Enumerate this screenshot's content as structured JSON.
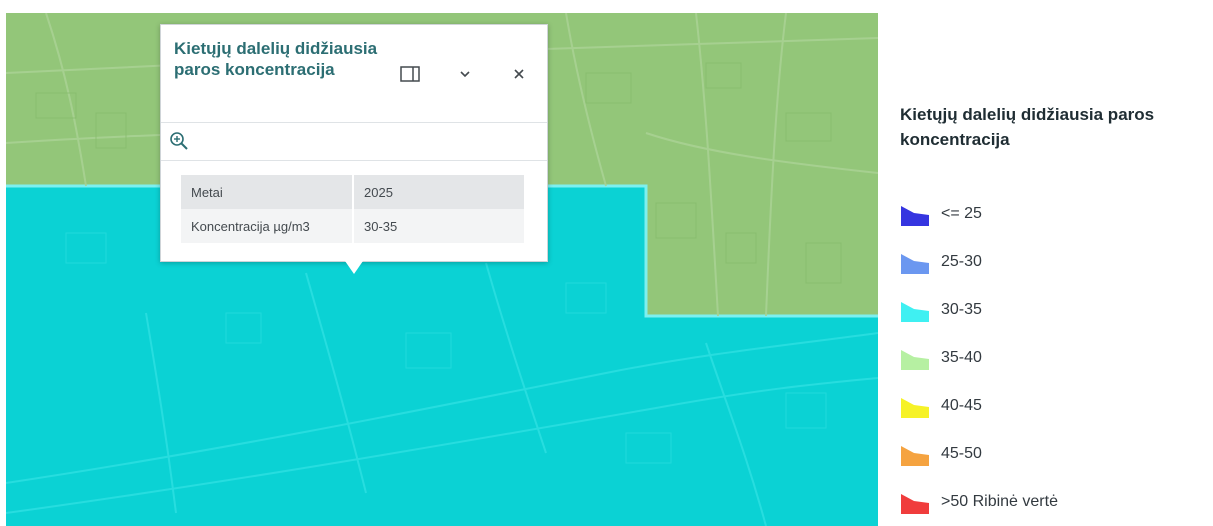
{
  "popup": {
    "title": "Kietųjų dalelių didžiausia paros koncentracija",
    "buttons": {
      "dock_icon": "dock-panel-icon",
      "collapse_icon": "chevron-down-icon",
      "close_icon": "close-icon",
      "zoom_icon": "zoom-to-icon"
    },
    "attributes": [
      {
        "key": "Metai",
        "value": "2025"
      },
      {
        "key": "Koncentracija µg/m3",
        "value": "30-35"
      }
    ]
  },
  "legend": {
    "title": "Kietųjų dalelių didžiausia paros koncentracija",
    "items": [
      {
        "label": "<= 25",
        "color": "#3535e0"
      },
      {
        "label": "25-30",
        "color": "#6b97f0"
      },
      {
        "label": "30-35",
        "color": "#3ff0f2"
      },
      {
        "label": "35-40",
        "color": "#b6f0a2"
      },
      {
        "label": "40-45",
        "color": "#f6f227"
      },
      {
        "label": "45-50",
        "color": "#f5a340"
      },
      {
        "label": ">50 Ribinė vertė",
        "color": "#f03c3c"
      }
    ]
  },
  "map": {
    "colors": {
      "green_zone": "#93c679",
      "cyan_zone": "#0bd2d4",
      "zone_border": "#7cf0f0"
    }
  }
}
